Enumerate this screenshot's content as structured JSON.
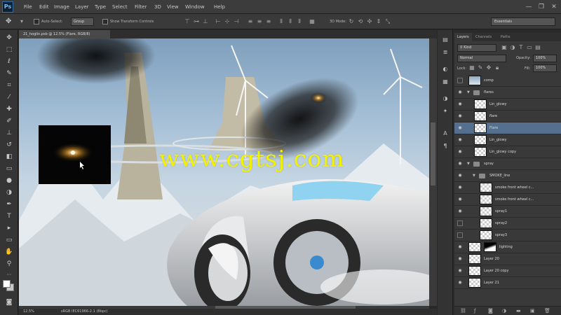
{
  "app": {
    "logo": "Ps"
  },
  "menu": [
    "File",
    "Edit",
    "Image",
    "Layer",
    "Type",
    "Select",
    "Filter",
    "3D",
    "View",
    "Window",
    "Help"
  ],
  "window_controls": {
    "minimize": "—",
    "restore": "❐",
    "close": "✕"
  },
  "options": {
    "auto_select_label": "Auto-Select:",
    "auto_select_value": "Group",
    "transform_label": "Show Transform Controls",
    "mode_label": "3D Mode:",
    "workspace": "Essentials"
  },
  "document": {
    "tab_title": "21_hoglin.psb @ 12.5% (Flare, RGB/8)"
  },
  "canvas": {
    "watermark": "www.cgtsj.com"
  },
  "status": {
    "zoom": "12.5%",
    "profile": "sRGB IEC61966-2.1 (8bpc)"
  },
  "layers_panel": {
    "tabs": [
      "Layers",
      "Channels",
      "Paths"
    ],
    "filter": "Kind",
    "blend_mode": "Normal",
    "opacity_label": "Opacity:",
    "opacity_value": "100%",
    "lock_label": "Lock:",
    "fill_label": "Fill:",
    "fill_value": "100%",
    "rows": [
      {
        "name": "comp",
        "type": "layer",
        "visible": false,
        "indent": 0
      },
      {
        "name": "flares",
        "type": "group",
        "visible": true,
        "indent": 0
      },
      {
        "name": "Lin_glowy",
        "type": "layer",
        "visible": true,
        "indent": 1
      },
      {
        "name": "flare",
        "type": "layer",
        "visible": true,
        "indent": 1
      },
      {
        "name": "Flare",
        "type": "layer",
        "visible": true,
        "indent": 1,
        "selected": true
      },
      {
        "name": "Lin_glowy",
        "type": "layer",
        "visible": true,
        "indent": 1
      },
      {
        "name": "Lin_glowy copy",
        "type": "layer",
        "visible": true,
        "indent": 1
      },
      {
        "name": "spray",
        "type": "group",
        "visible": true,
        "indent": 0
      },
      {
        "name": "SMOKE_line",
        "type": "group",
        "visible": true,
        "indent": 1
      },
      {
        "name": "smoke front wheel c...",
        "type": "layer",
        "visible": true,
        "indent": 2
      },
      {
        "name": "smoke front wheel c...",
        "type": "layer",
        "visible": true,
        "indent": 2
      },
      {
        "name": "spray1",
        "type": "layer",
        "visible": true,
        "indent": 2
      },
      {
        "name": "spray2",
        "type": "layer",
        "visible": false,
        "indent": 2
      },
      {
        "name": "spray3",
        "type": "layer",
        "visible": false,
        "indent": 2
      },
      {
        "name": "lighting",
        "type": "masked",
        "visible": true,
        "indent": 0
      },
      {
        "name": "Layer 20",
        "type": "layer",
        "visible": true,
        "indent": 0
      },
      {
        "name": "Layer 20 copy",
        "type": "layer",
        "visible": true,
        "indent": 0
      },
      {
        "name": "Layer 21",
        "type": "layer",
        "visible": true,
        "indent": 0
      }
    ]
  },
  "colors": {
    "accent": "#55708f",
    "watermark": "#f2f200",
    "panel": "#393939"
  }
}
